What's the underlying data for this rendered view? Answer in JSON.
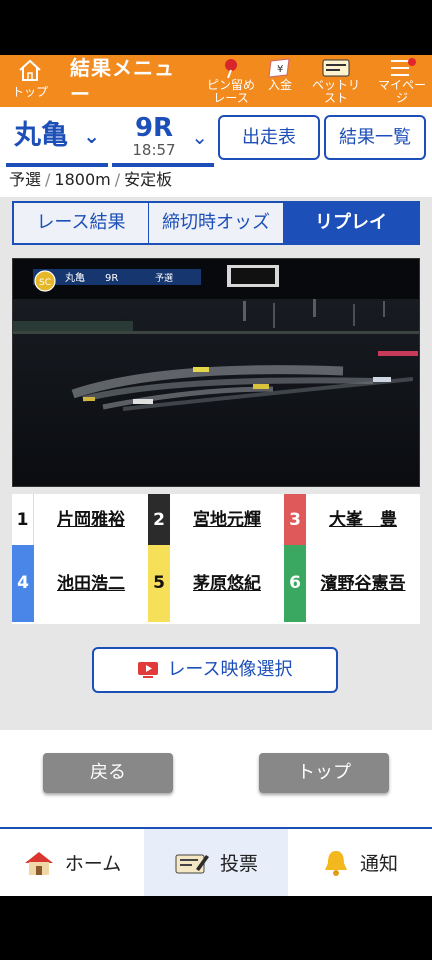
{
  "topbar": {
    "home_label": "トップ",
    "title": "結果メニュー",
    "items": [
      {
        "label": "ピン留めレース",
        "icon": "pin-icon"
      },
      {
        "label": "入金",
        "icon": "yen-icon"
      },
      {
        "label": "ベットリスト",
        "icon": "betlist-icon"
      },
      {
        "label": "マイページ",
        "icon": "menu-icon"
      }
    ],
    "accent": "#f28a1e"
  },
  "race": {
    "venue": "丸亀",
    "number": "9R",
    "time": "18:57",
    "entry_button": "出走表",
    "results_button": "結果一覧",
    "info": [
      "予選",
      "1800m",
      "安定板"
    ]
  },
  "tabs": [
    {
      "label": "レース結果",
      "active": false
    },
    {
      "label": "締切時オッズ",
      "active": false
    },
    {
      "label": "リプレイ",
      "active": true
    }
  ],
  "video": {
    "overlay_venue": "丸亀",
    "overlay_race": "9R",
    "overlay_type": "予選"
  },
  "racers": [
    {
      "no": "1",
      "name": "片岡雅裕",
      "color": "#ffffff",
      "text": "#111111"
    },
    {
      "no": "2",
      "name": "宮地元輝",
      "color": "#2b2b2b",
      "text": "#ffffff"
    },
    {
      "no": "3",
      "name": "大峯　豊",
      "color": "#e0595a",
      "text": "#ffffff"
    },
    {
      "no": "4",
      "name": "池田浩二",
      "color": "#4a86e8",
      "text": "#ffffff"
    },
    {
      "no": "5",
      "name": "茅原悠紀",
      "color": "#f6e05a",
      "text": "#111111"
    },
    {
      "no": "6",
      "name": "濱野谷憲吾",
      "color": "#3aa860",
      "text": "#ffffff"
    }
  ],
  "video_select_label": "レース映像選択",
  "buttons": {
    "back": "戻る",
    "top": "トップ"
  },
  "bottom_nav": [
    {
      "label": "ホーム",
      "icon": "home-icon",
      "active": false
    },
    {
      "label": "投票",
      "icon": "vote-icon",
      "active": true
    },
    {
      "label": "通知",
      "icon": "bell-icon",
      "active": false
    }
  ]
}
